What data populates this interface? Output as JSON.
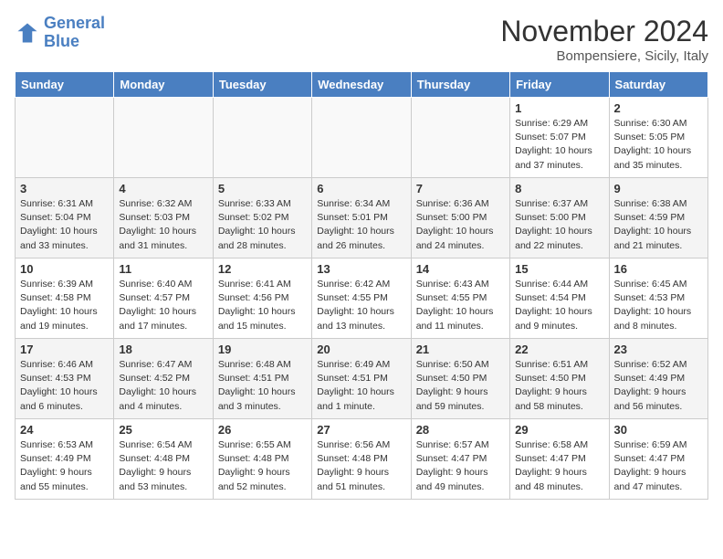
{
  "header": {
    "logo_line1": "General",
    "logo_line2": "Blue",
    "month_title": "November 2024",
    "subtitle": "Bompensiere, Sicily, Italy"
  },
  "weekdays": [
    "Sunday",
    "Monday",
    "Tuesday",
    "Wednesday",
    "Thursday",
    "Friday",
    "Saturday"
  ],
  "weeks": [
    [
      {
        "day": "",
        "info": ""
      },
      {
        "day": "",
        "info": ""
      },
      {
        "day": "",
        "info": ""
      },
      {
        "day": "",
        "info": ""
      },
      {
        "day": "",
        "info": ""
      },
      {
        "day": "1",
        "info": "Sunrise: 6:29 AM\nSunset: 5:07 PM\nDaylight: 10 hours and 37 minutes."
      },
      {
        "day": "2",
        "info": "Sunrise: 6:30 AM\nSunset: 5:05 PM\nDaylight: 10 hours and 35 minutes."
      }
    ],
    [
      {
        "day": "3",
        "info": "Sunrise: 6:31 AM\nSunset: 5:04 PM\nDaylight: 10 hours and 33 minutes."
      },
      {
        "day": "4",
        "info": "Sunrise: 6:32 AM\nSunset: 5:03 PM\nDaylight: 10 hours and 31 minutes."
      },
      {
        "day": "5",
        "info": "Sunrise: 6:33 AM\nSunset: 5:02 PM\nDaylight: 10 hours and 28 minutes."
      },
      {
        "day": "6",
        "info": "Sunrise: 6:34 AM\nSunset: 5:01 PM\nDaylight: 10 hours and 26 minutes."
      },
      {
        "day": "7",
        "info": "Sunrise: 6:36 AM\nSunset: 5:00 PM\nDaylight: 10 hours and 24 minutes."
      },
      {
        "day": "8",
        "info": "Sunrise: 6:37 AM\nSunset: 5:00 PM\nDaylight: 10 hours and 22 minutes."
      },
      {
        "day": "9",
        "info": "Sunrise: 6:38 AM\nSunset: 4:59 PM\nDaylight: 10 hours and 21 minutes."
      }
    ],
    [
      {
        "day": "10",
        "info": "Sunrise: 6:39 AM\nSunset: 4:58 PM\nDaylight: 10 hours and 19 minutes."
      },
      {
        "day": "11",
        "info": "Sunrise: 6:40 AM\nSunset: 4:57 PM\nDaylight: 10 hours and 17 minutes."
      },
      {
        "day": "12",
        "info": "Sunrise: 6:41 AM\nSunset: 4:56 PM\nDaylight: 10 hours and 15 minutes."
      },
      {
        "day": "13",
        "info": "Sunrise: 6:42 AM\nSunset: 4:55 PM\nDaylight: 10 hours and 13 minutes."
      },
      {
        "day": "14",
        "info": "Sunrise: 6:43 AM\nSunset: 4:55 PM\nDaylight: 10 hours and 11 minutes."
      },
      {
        "day": "15",
        "info": "Sunrise: 6:44 AM\nSunset: 4:54 PM\nDaylight: 10 hours and 9 minutes."
      },
      {
        "day": "16",
        "info": "Sunrise: 6:45 AM\nSunset: 4:53 PM\nDaylight: 10 hours and 8 minutes."
      }
    ],
    [
      {
        "day": "17",
        "info": "Sunrise: 6:46 AM\nSunset: 4:53 PM\nDaylight: 10 hours and 6 minutes."
      },
      {
        "day": "18",
        "info": "Sunrise: 6:47 AM\nSunset: 4:52 PM\nDaylight: 10 hours and 4 minutes."
      },
      {
        "day": "19",
        "info": "Sunrise: 6:48 AM\nSunset: 4:51 PM\nDaylight: 10 hours and 3 minutes."
      },
      {
        "day": "20",
        "info": "Sunrise: 6:49 AM\nSunset: 4:51 PM\nDaylight: 10 hours and 1 minute."
      },
      {
        "day": "21",
        "info": "Sunrise: 6:50 AM\nSunset: 4:50 PM\nDaylight: 9 hours and 59 minutes."
      },
      {
        "day": "22",
        "info": "Sunrise: 6:51 AM\nSunset: 4:50 PM\nDaylight: 9 hours and 58 minutes."
      },
      {
        "day": "23",
        "info": "Sunrise: 6:52 AM\nSunset: 4:49 PM\nDaylight: 9 hours and 56 minutes."
      }
    ],
    [
      {
        "day": "24",
        "info": "Sunrise: 6:53 AM\nSunset: 4:49 PM\nDaylight: 9 hours and 55 minutes."
      },
      {
        "day": "25",
        "info": "Sunrise: 6:54 AM\nSunset: 4:48 PM\nDaylight: 9 hours and 53 minutes."
      },
      {
        "day": "26",
        "info": "Sunrise: 6:55 AM\nSunset: 4:48 PM\nDaylight: 9 hours and 52 minutes."
      },
      {
        "day": "27",
        "info": "Sunrise: 6:56 AM\nSunset: 4:48 PM\nDaylight: 9 hours and 51 minutes."
      },
      {
        "day": "28",
        "info": "Sunrise: 6:57 AM\nSunset: 4:47 PM\nDaylight: 9 hours and 49 minutes."
      },
      {
        "day": "29",
        "info": "Sunrise: 6:58 AM\nSunset: 4:47 PM\nDaylight: 9 hours and 48 minutes."
      },
      {
        "day": "30",
        "info": "Sunrise: 6:59 AM\nSunset: 4:47 PM\nDaylight: 9 hours and 47 minutes."
      }
    ]
  ]
}
